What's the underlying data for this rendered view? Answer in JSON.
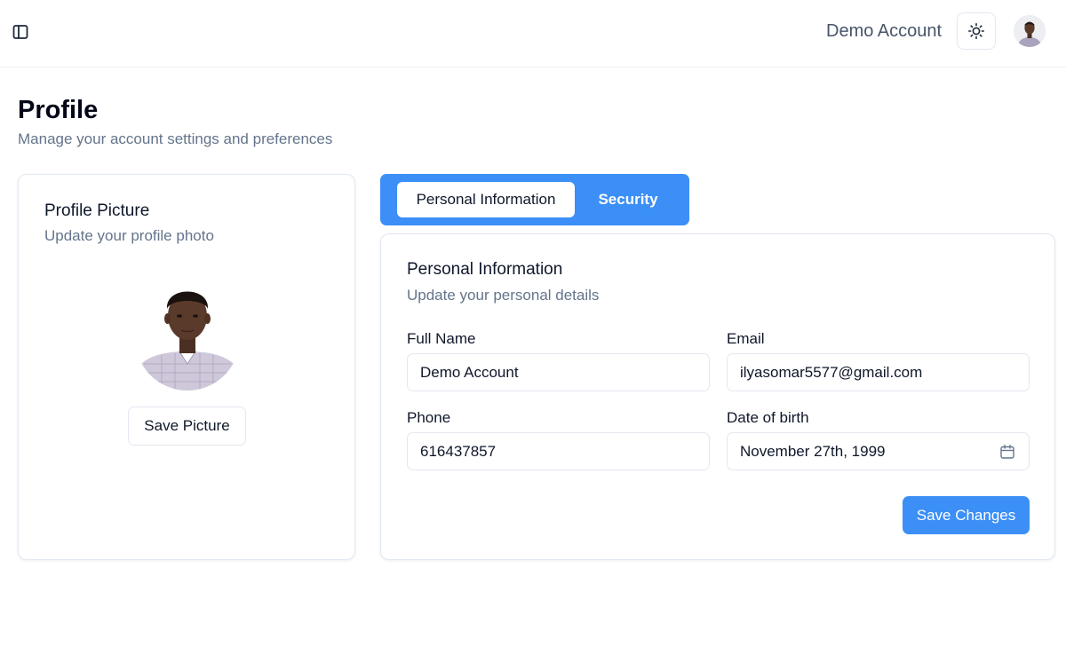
{
  "topbar": {
    "sidebar_toggle_icon": "sidebar-panel-icon",
    "account_name": "Demo Account",
    "theme_icon": "sun-icon",
    "avatar_icon": "user-avatar"
  },
  "page": {
    "title": "Profile",
    "subtitle": "Manage your account settings and preferences"
  },
  "picture_card": {
    "title": "Profile Picture",
    "subtitle": "Update your profile photo",
    "save_label": "Save Picture"
  },
  "tabs": [
    {
      "label": "Personal Information",
      "active": true
    },
    {
      "label": "Security",
      "active": false
    }
  ],
  "personal": {
    "title": "Personal Information",
    "subtitle": "Update your personal details",
    "full_name": {
      "label": "Full Name",
      "value": "Demo Account"
    },
    "email": {
      "label": "Email",
      "value": "ilyasomar5577@gmail.com"
    },
    "phone": {
      "label": "Phone",
      "value": "616437857"
    },
    "dob": {
      "label": "Date of birth",
      "value": "November 27th, 1999",
      "icon": "calendar-icon"
    },
    "save_label": "Save Changes"
  },
  "colors": {
    "accent": "#3b8ff6",
    "muted_text": "#64748b",
    "border": "#e2e8f0"
  }
}
